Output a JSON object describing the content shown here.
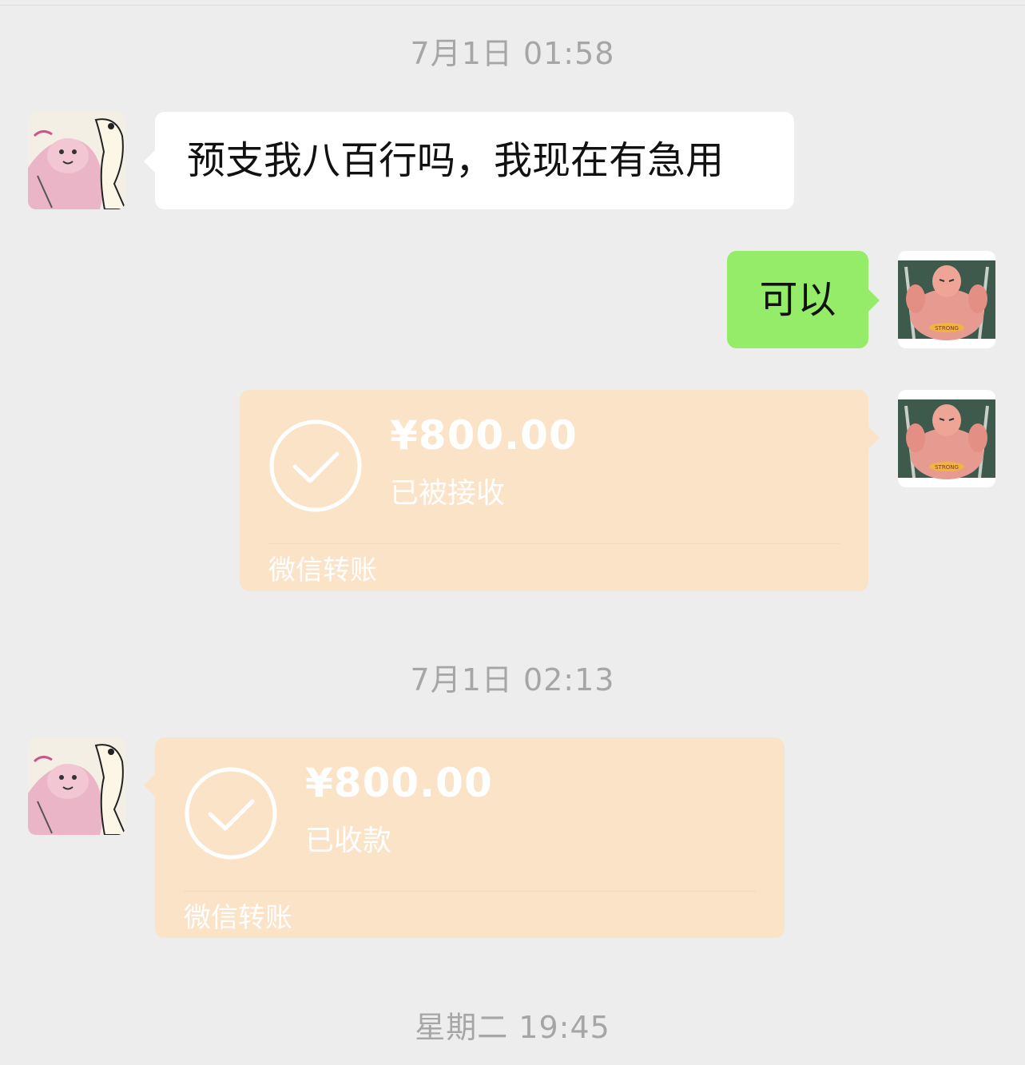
{
  "timestamps": {
    "first": "7月1日 01:58",
    "second": "7月1日 02:13",
    "third": "星期二 19:45"
  },
  "messages": {
    "incoming_text": "预支我八百行吗，我现在有急用",
    "outgoing_text": "可以"
  },
  "transfers": [
    {
      "amount": "¥800.00",
      "status": "已被接收",
      "label": "微信转账"
    },
    {
      "amount": "¥800.00",
      "status": "已收款",
      "label": "微信转账"
    }
  ],
  "avatars": {
    "contact": "cartoon-pink-avatar",
    "self": "muscle-man-avatar",
    "self_badge_text": "STRONG"
  },
  "colors": {
    "background": "#ededed",
    "incoming_bubble": "#ffffff",
    "outgoing_bubble": "#95ec69",
    "transfer_bubble": "#fbe3c8",
    "timestamp_text": "#a6a6a6"
  }
}
